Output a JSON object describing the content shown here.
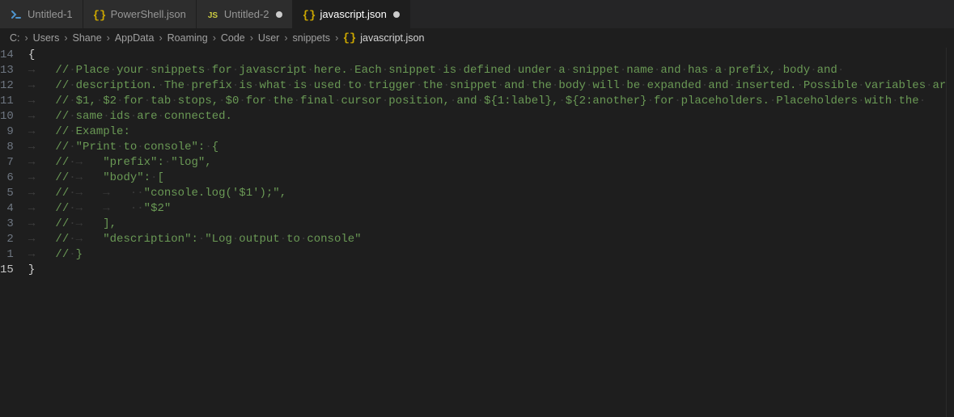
{
  "tabs": [
    {
      "label": "Untitled-1",
      "iconType": "powershell",
      "iconColor": "#4e94ce",
      "dirty": false,
      "active": false
    },
    {
      "label": "PowerShell.json",
      "iconType": "braces",
      "iconColor": "#cca700",
      "dirty": false,
      "active": false
    },
    {
      "label": "Untitled-2",
      "iconType": "js",
      "iconColor": "#cbcb41",
      "dirty": true,
      "active": false
    },
    {
      "label": "javascript.json",
      "iconType": "braces",
      "iconColor": "#cca700",
      "dirty": true,
      "active": true
    }
  ],
  "breadcrumb": {
    "segments": [
      "C:",
      "Users",
      "Shane",
      "AppData",
      "Roaming",
      "Code",
      "User",
      "snippets"
    ],
    "final": {
      "iconType": "braces",
      "iconColor": "#cca700",
      "label": "javascript.json"
    }
  },
  "editor": {
    "lineNumbers": [
      14,
      13,
      12,
      11,
      10,
      9,
      8,
      7,
      6,
      5,
      4,
      3,
      2,
      1,
      15
    ],
    "currentLine": 15,
    "lines": [
      {
        "indent": 0,
        "type": "brace",
        "text": "{"
      },
      {
        "indent": 1,
        "type": "comment",
        "text": "// Place your snippets for javascript here. Each snippet is defined under a snippet name and has a prefix, body and "
      },
      {
        "indent": 1,
        "type": "comment",
        "text": "// description. The prefix is what is used to trigger the snippet and the body will be expanded and inserted. Possible variables are:"
      },
      {
        "indent": 1,
        "type": "comment",
        "text": "// $1, $2 for tab stops, $0 for the final cursor position, and ${1:label}, ${2:another} for placeholders. Placeholders with the "
      },
      {
        "indent": 1,
        "type": "comment",
        "text": "// same ids are connected."
      },
      {
        "indent": 1,
        "type": "comment",
        "text": "// Example:"
      },
      {
        "indent": 1,
        "type": "comment",
        "text": "// \"Print to console\": {"
      },
      {
        "indent": 1,
        "type": "comment",
        "text": "// →\"prefix\": \"log\","
      },
      {
        "indent": 1,
        "type": "comment",
        "text": "// →\"body\": ["
      },
      {
        "indent": 1,
        "type": "comment",
        "text": "// →→  \"console.log('$1');\","
      },
      {
        "indent": 1,
        "type": "comment",
        "text": "// →→  \"$2\""
      },
      {
        "indent": 1,
        "type": "comment",
        "text": "// →],"
      },
      {
        "indent": 1,
        "type": "comment",
        "text": "// →\"description\": \"Log output to console\""
      },
      {
        "indent": 1,
        "type": "comment",
        "text": "// }"
      },
      {
        "indent": 0,
        "type": "brace",
        "text": "}"
      }
    ]
  }
}
